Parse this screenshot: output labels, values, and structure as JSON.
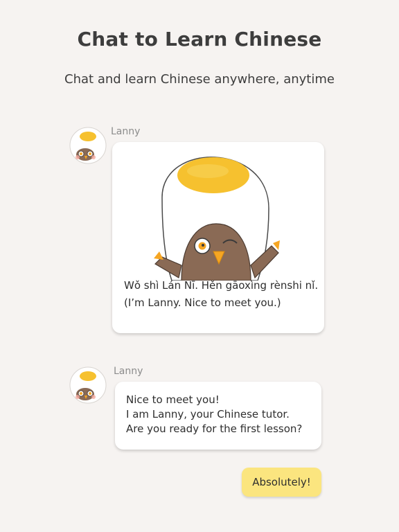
{
  "header": {
    "title": "Chat to Learn Chinese",
    "subtitle": "Chat and learn Chinese anywhere, anytime"
  },
  "messages": [
    {
      "sender": "Lanny",
      "image": "egg-bird-illustration",
      "pinyin": "Wǒ shì Lán Nī. Hěn gāoxìng rènshi nǐ.",
      "translation": "(I’m Lanny. Nice to meet you.)"
    },
    {
      "sender": "Lanny",
      "lines": [
        "Nice to meet you!",
        "I am Lanny, your Chinese tutor.",
        "Are you ready for the first lesson?"
      ]
    }
  ],
  "reply": {
    "label": "Absolutely!"
  },
  "colors": {
    "background": "#f6f3f1",
    "reply_bubble": "#fbe57f",
    "yolk": "#f6c12f"
  }
}
